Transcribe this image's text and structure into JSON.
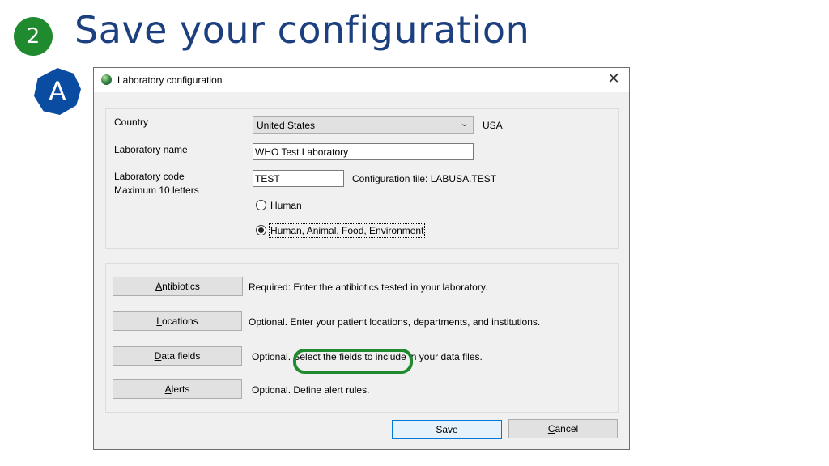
{
  "slide": {
    "step_number": "2",
    "title": "Save your configuration",
    "marker": "A",
    "colors": {
      "step_badge": "#1f8a2e",
      "title": "#1b3f7f",
      "marker": "#0b4ca3",
      "highlight": "#1f8a2e"
    }
  },
  "dialog": {
    "title": "Laboratory configuration",
    "close_icon": "close-icon",
    "settings": {
      "country_label": "Country",
      "country_value": "United States",
      "country_code": "USA",
      "lab_name_label": "Laboratory name",
      "lab_name_value": "WHO Test Laboratory",
      "lab_code_label": "Laboratory code",
      "lab_code_hint": "Maximum 10 letters",
      "lab_code_value": "TEST",
      "config_file_text": "Configuration file: LABUSA.TEST",
      "radio_options": [
        {
          "label": "Human",
          "checked": false
        },
        {
          "label": "Human, Animal, Food, Environment",
          "checked": true
        }
      ]
    },
    "modules": [
      {
        "mnemonic": "A",
        "rest": "ntibiotics",
        "description": "Required:  Enter the antibiotics tested in your laboratory."
      },
      {
        "mnemonic": "L",
        "rest": "ocations",
        "description": "Optional. Enter your patient locations, departments, and institutions."
      },
      {
        "mnemonic": "D",
        "rest": "ata fields",
        "description": "Optional. Select the fields to include in your data files."
      },
      {
        "mnemonic": "A",
        "rest": "lerts",
        "description": "Optional. Define alert rules."
      }
    ],
    "footer": {
      "save_mnemonic": "S",
      "save_rest": "ave",
      "cancel_mnemonic": "C",
      "cancel_rest": "ancel"
    }
  }
}
